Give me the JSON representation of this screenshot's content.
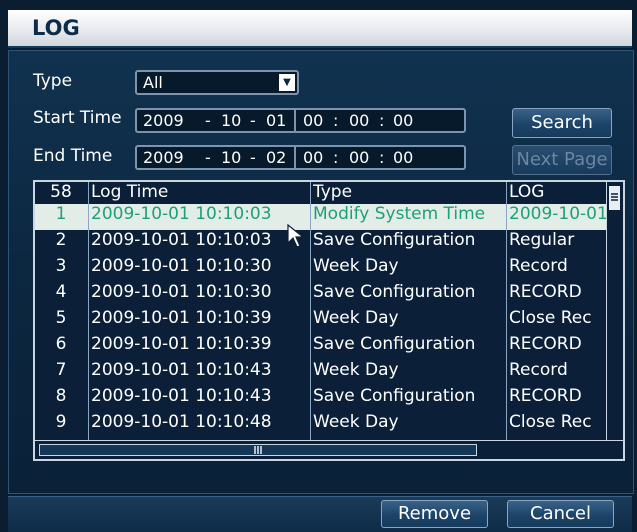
{
  "window": {
    "title": "LOG"
  },
  "filters": {
    "type_label": "Type",
    "type_value": "All",
    "start_label": "Start Time",
    "start_date": {
      "year": "2009",
      "month": "10",
      "day": "01"
    },
    "start_time": {
      "h": "00",
      "m": "00",
      "s": "00"
    },
    "end_label": "End Time",
    "end_date": {
      "year": "2009",
      "month": "10",
      "day": "02"
    },
    "end_time": {
      "h": "00",
      "m": "00",
      "s": "00"
    },
    "date_sep": "-",
    "time_sep": ":"
  },
  "buttons": {
    "search": "Search",
    "next_page": "Next Page",
    "remove": "Remove",
    "cancel": "Cancel"
  },
  "table": {
    "headers": {
      "count": "58",
      "time": "Log Time",
      "type": "Type",
      "log": "LOG"
    },
    "rows": [
      {
        "num": "1",
        "time": "2009-10-01 10:10:03",
        "type": "Modify System Time",
        "log": "2009-10-01"
      },
      {
        "num": "2",
        "time": "2009-10-01 10:10:03",
        "type": "Save Configuration",
        "log": "Regular"
      },
      {
        "num": "3",
        "time": "2009-10-01 10:10:30",
        "type": "Week Day",
        "log": "Record"
      },
      {
        "num": "4",
        "time": "2009-10-01 10:10:30",
        "type": "Save Configuration",
        "log": "RECORD"
      },
      {
        "num": "5",
        "time": "2009-10-01 10:10:39",
        "type": "Week Day",
        "log": "Close Rec"
      },
      {
        "num": "6",
        "time": "2009-10-01 10:10:39",
        "type": "Save Configuration",
        "log": "RECORD"
      },
      {
        "num": "7",
        "time": "2009-10-01 10:10:43",
        "type": "Week Day",
        "log": "Record"
      },
      {
        "num": "8",
        "time": "2009-10-01 10:10:43",
        "type": "Save Configuration",
        "log": "RECORD"
      },
      {
        "num": "9",
        "time": "2009-10-01 10:10:48",
        "type": "Week Day",
        "log": "Close Rec"
      }
    ]
  },
  "colors": {
    "background": "#0b1d30",
    "selected_row_bg": "#e3ede8",
    "selected_row_text": "#1f9e7b"
  },
  "icons": {
    "dropdown": "chevron-down-icon",
    "pointer": "mouse-pointer-icon",
    "scroll_grip": "grip-icon"
  }
}
